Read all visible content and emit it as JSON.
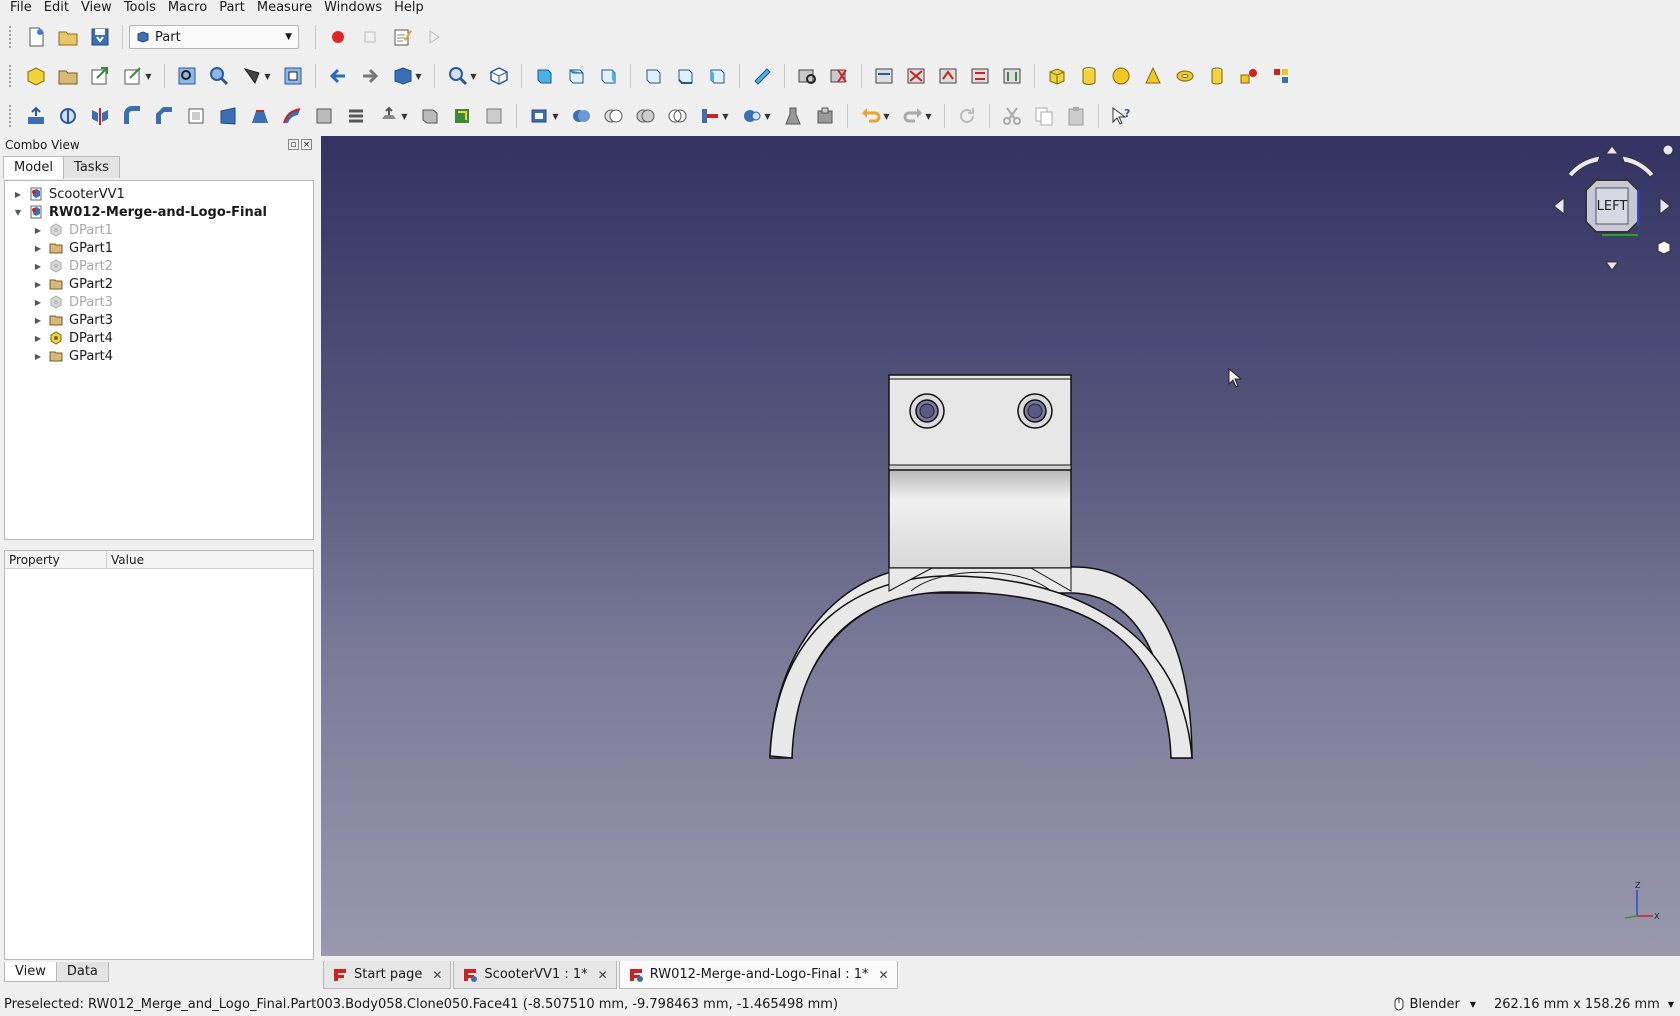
{
  "menu": [
    "File",
    "Edit",
    "View",
    "Tools",
    "Macro",
    "Part",
    "Measure",
    "Windows",
    "Help"
  ],
  "workbench": {
    "selected": "Part"
  },
  "combo_view": {
    "title": "Combo View",
    "tabs": [
      "Model",
      "Tasks"
    ],
    "tree": [
      {
        "label": "ScooterVV1",
        "level": 0,
        "expanded": false,
        "bold": false,
        "dim": false,
        "icon": "document-icon"
      },
      {
        "label": "RW012-Merge-and-Logo-Final",
        "level": 0,
        "expanded": true,
        "bold": true,
        "dim": false,
        "icon": "document-icon"
      },
      {
        "label": "DPart1",
        "level": 1,
        "expanded": false,
        "bold": false,
        "dim": true,
        "icon": "part-icon"
      },
      {
        "label": "GPart1",
        "level": 1,
        "expanded": false,
        "bold": false,
        "dim": false,
        "icon": "folder-icon"
      },
      {
        "label": "DPart2",
        "level": 1,
        "expanded": false,
        "bold": false,
        "dim": true,
        "icon": "part-icon"
      },
      {
        "label": "GPart2",
        "level": 1,
        "expanded": false,
        "bold": false,
        "dim": false,
        "icon": "folder-icon"
      },
      {
        "label": "DPart3",
        "level": 1,
        "expanded": false,
        "bold": false,
        "dim": true,
        "icon": "part-icon"
      },
      {
        "label": "GPart3",
        "level": 1,
        "expanded": false,
        "bold": false,
        "dim": false,
        "icon": "folder-icon"
      },
      {
        "label": "DPart4",
        "level": 1,
        "expanded": false,
        "bold": false,
        "dim": false,
        "icon": "part-icon-active"
      },
      {
        "label": "GPart4",
        "level": 1,
        "expanded": false,
        "bold": false,
        "dim": false,
        "icon": "folder-icon"
      }
    ],
    "property_header": {
      "property": "Property",
      "value": "Value"
    },
    "bottom_tabs": [
      "View",
      "Data"
    ]
  },
  "navcube": {
    "face": "LEFT"
  },
  "axis": {
    "z": "Z",
    "x": "X"
  },
  "doc_tabs": [
    {
      "label": "Start page",
      "active": false
    },
    {
      "label": "ScooterVV1 : 1*",
      "active": false
    },
    {
      "label": "RW012-Merge-and-Logo-Final : 1*",
      "active": true
    }
  ],
  "status": {
    "message": "Preselected: RW012_Merge_and_Logo_Final.Part003.Body058.Clone050.Face41 (-8.507510 mm, -9.798463 mm, -1.465498 mm)",
    "navigation": "Blender",
    "dimensions": "262.16 mm x 158.26 mm"
  },
  "colors": {
    "viewport_top": "#333364",
    "viewport_bottom": "#9898ae",
    "part_fill": "#e6e6e6",
    "record_red": "#e0262b"
  }
}
